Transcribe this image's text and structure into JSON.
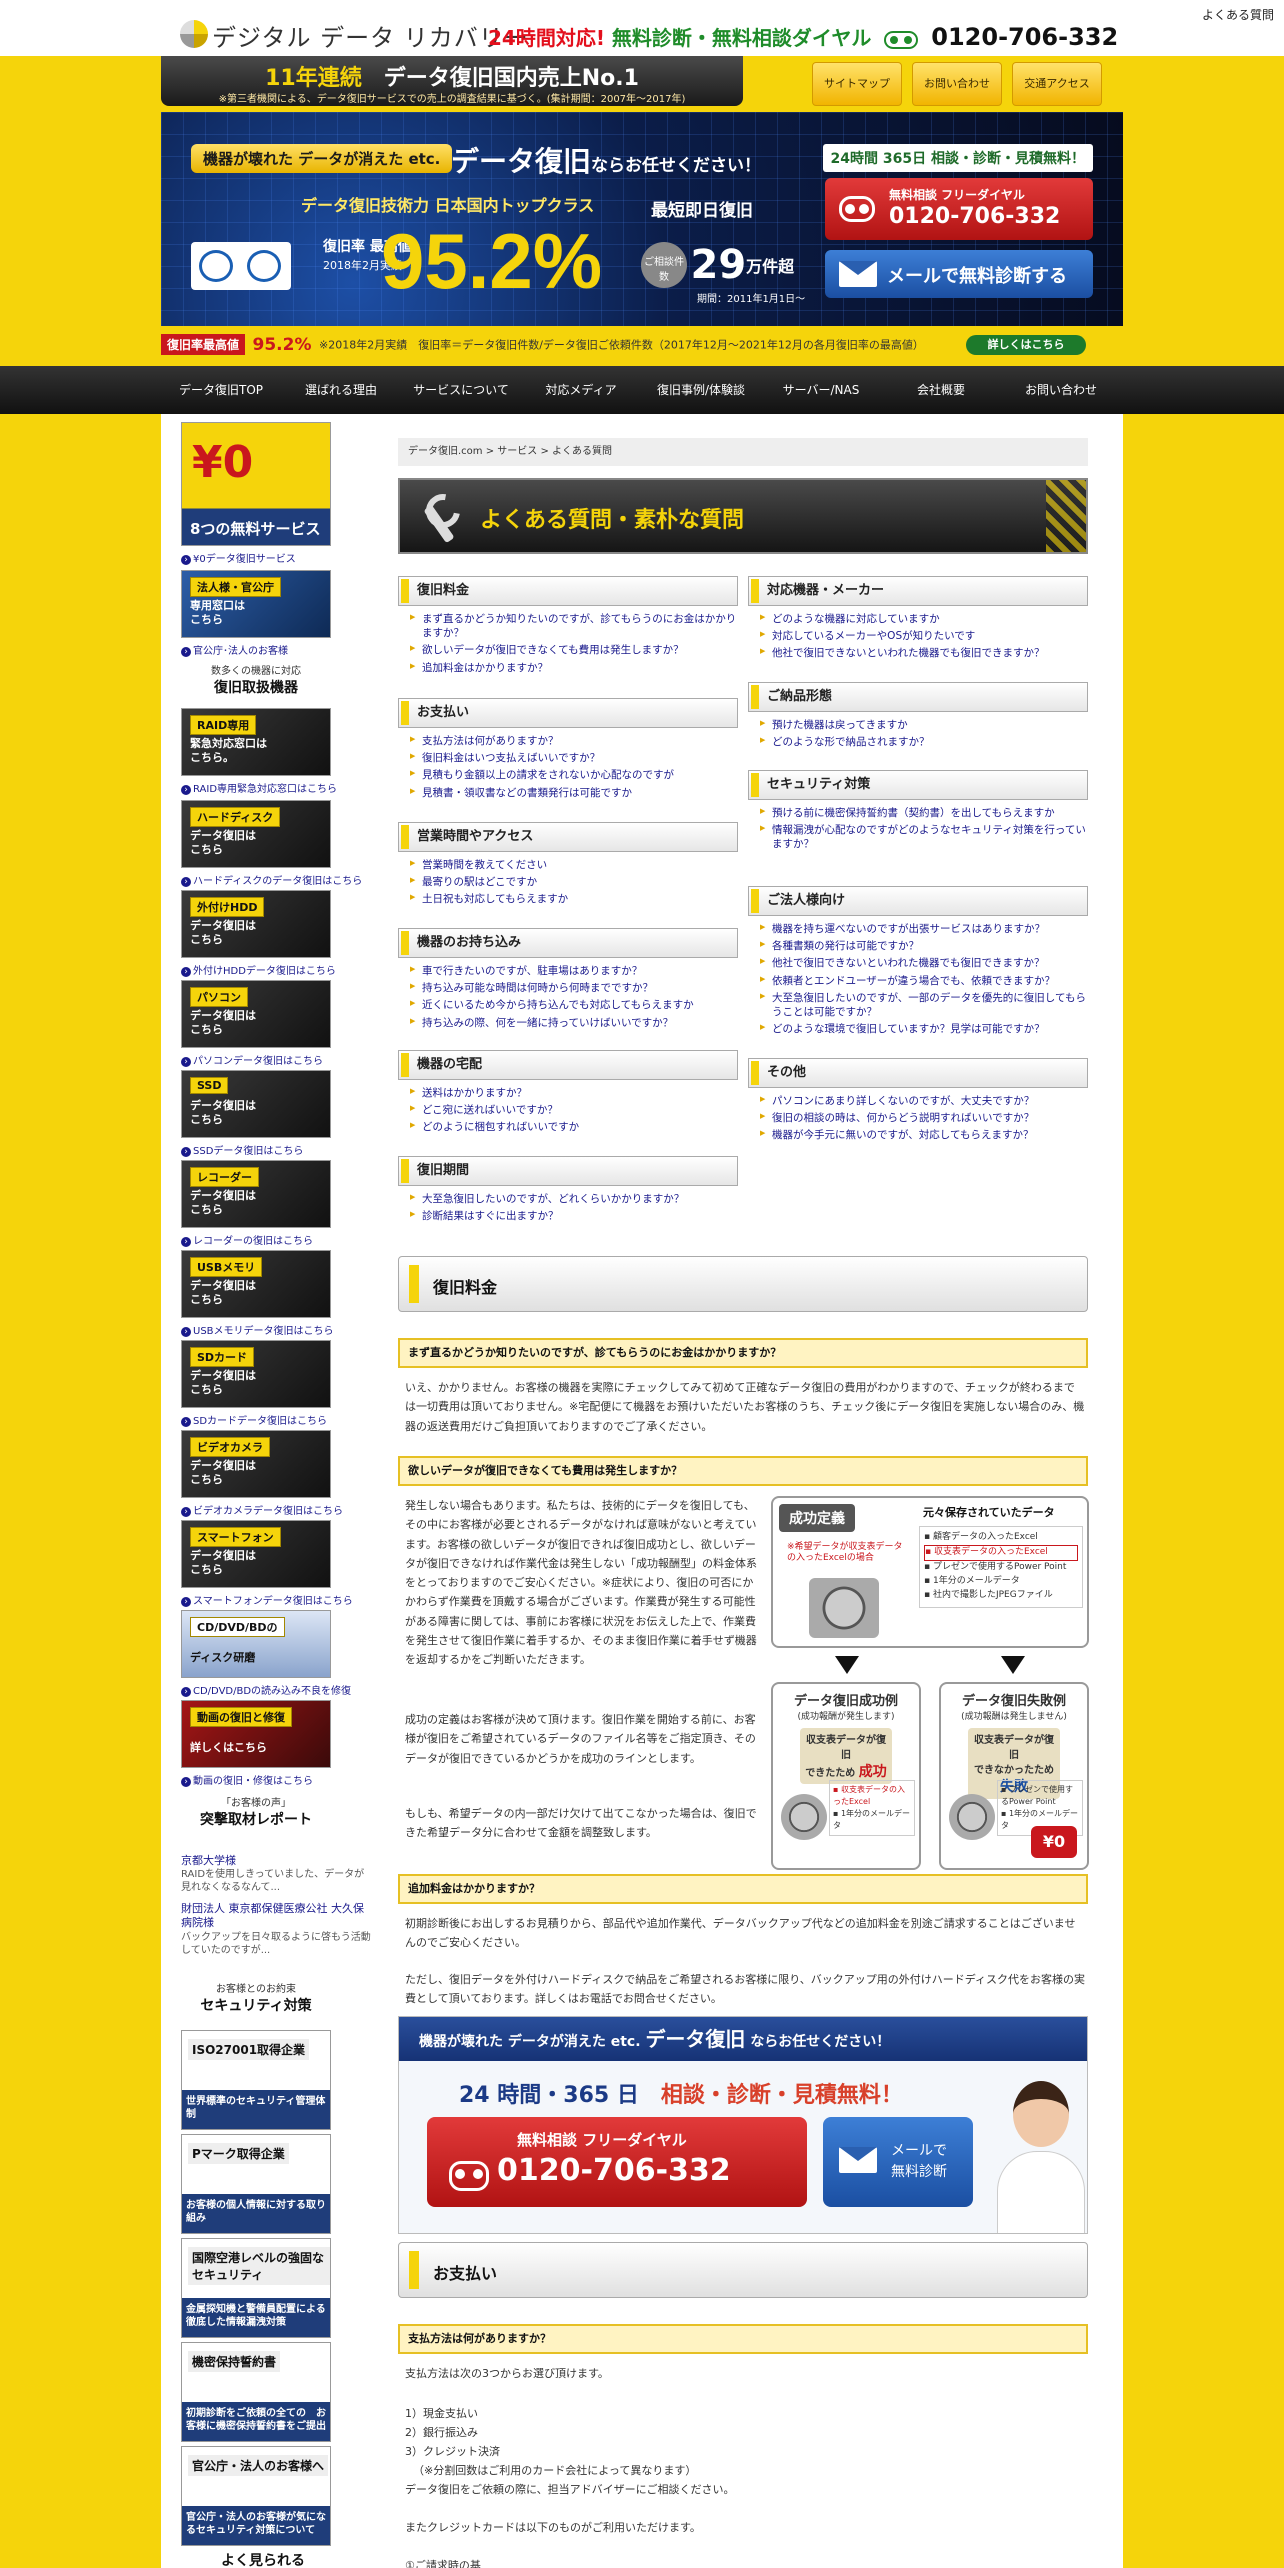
{
  "header": {
    "logo": "デジタル データ リカバリー",
    "faq_link": "よくある質問",
    "phone_prefix_red": "24時間対応!",
    "phone_prefix_green": "無料診断・無料相談ダイヤル",
    "phone_number": "0120-706-332"
  },
  "ribbon": {
    "title_prefix": "11年連続",
    "title_main": "データ復旧国内売上No.1",
    "note": "※第三者機関による、データ復旧サービスでの売上の調査結果に基づく。(集計期間：2007年～2017年)"
  },
  "top_links": [
    "サイトマップ",
    "お問い合わせ",
    "交通アクセス"
  ],
  "hero": {
    "pill": "機器が壊れた データが消えた etc.",
    "main_copy": "データ復旧",
    "main_copy_suffix": "ならお任せください！",
    "skill": "データ復旧技術力 日本国内トップクラス",
    "fast": "最短即日復旧",
    "rate_label": "復旧率 最高値",
    "rate_date": "2018年2月実績",
    "rate": "95.2%",
    "consult_label": "ご相談件数",
    "consult_count": "29",
    "consult_unit": "万件超",
    "period": "期間：2011年1月1日～",
    "r365": "24時間 365日 相談・診断・見積無料！",
    "dial_title": "無料相談 フリーダイヤル",
    "dial_number": "0120-706-332",
    "mail_label": "メールで無料診断する"
  },
  "rate_strip": {
    "label": "復旧率最高値",
    "pct": "95.2%",
    "note": "※2018年2月実績　復旧率＝データ復旧件数/データ復旧ご依頼件数（2017年12月～2021年12月の各月復旧率の最高値）",
    "detail": "詳しくはこちら"
  },
  "nav": [
    "データ復旧TOP",
    "選ばれる理由",
    "サービスについて",
    "対応メディア",
    "復旧事例/体験談",
    "サーバー/NAS",
    "会社概要",
    "お問い合わせ"
  ],
  "sidebar": {
    "cards": [
      {
        "tag": "¥0",
        "text": "8つの無料サービス",
        "link": "¥0データ復旧サービス"
      },
      {
        "tag": "法人様・官公庁",
        "text": "専用窓口は\nこちら",
        "link": "官公庁･法人のお客様"
      },
      {
        "tag": "RAID専用",
        "text": "緊急対応窓口は\nこちら。",
        "link": "RAID専用緊急対応窓口はこちら"
      },
      {
        "tag": "ハードディスク",
        "text": "データ復旧は\nこちら",
        "link": "ハードディスクのデータ復旧はこちら"
      },
      {
        "tag": "外付けHDD",
        "text": "データ復旧は\nこちら",
        "link": "外付けHDDデータ復旧はこちら"
      },
      {
        "tag": "パソコン",
        "text": "データ復旧は\nこちら",
        "link": "パソコンデータ復旧はこちら"
      },
      {
        "tag": "SSD",
        "text": "データ復旧は\nこちら",
        "link": "SSDデータ復旧はこちら"
      },
      {
        "tag": "レコーダー",
        "text": "データ復旧は\nこちら",
        "link": "レコーダーの復旧はこちら"
      },
      {
        "tag": "USBメモリ",
        "text": "データ復旧は\nこちら",
        "link": "USBメモリデータ復旧はこちら"
      },
      {
        "tag": "SDカード",
        "text": "データ復旧は\nこちら",
        "link": "SDカードデータ復旧はこちら"
      },
      {
        "tag": "ビデオカメラ",
        "text": "データ復旧は\nこちら",
        "link": "ビデオカメラデータ復旧はこちら"
      },
      {
        "tag": "スマートフォン",
        "text": "データ復旧は\nこちら",
        "link": "スマートフォンデータ復旧はこちら"
      },
      {
        "tag": "CD/DVD/BDの",
        "text": "ディスク研磨",
        "link": "CD/DVD/BDの読み込み不良を修復"
      },
      {
        "tag": "動画の復旧と修復",
        "text": "詳しくはこちら",
        "link": "動画の復旧・修復はこちら"
      }
    ],
    "devices_title": "復旧取扱機器",
    "devices_sub": "数多くの機器に対応",
    "report_sub": "「お客様の声」",
    "report_title": "突撃取材レポート",
    "news": [
      {
        "title": "京都大学様",
        "desc": "RAIDを使用しきっていました、データが見れなくなるなんて..."
      },
      {
        "title": "財団法人 東京都保健医療公社 大久保病院様",
        "desc": "バックアップを日々取るように啓もう活動していたのですが..."
      }
    ],
    "security_sub": "お客様とのお約束",
    "security_title": "セキュリティ対策",
    "security": [
      {
        "head": "ISO27001取得企業",
        "foot": "世界標準のセキュリティ管理体制"
      },
      {
        "head": "Pマーク取得企業",
        "foot": "お客様の個人情報に対する取り組み"
      },
      {
        "head": "国際空港レベルの強固なセキュリティ",
        "foot": "金属探知機と警備員配置による徹底した情報漏洩対策"
      },
      {
        "head": "機密保持誓約書",
        "foot": "初期診断をご依頼の全ての　お客様に機密保持誓約書をご提出"
      },
      {
        "head": "官公庁・法人のお客様へ",
        "foot": "官公庁・法人のお客様が気になるセキュリティ対策について"
      }
    ],
    "bottom_title": "よく見られる"
  },
  "breadcrumb": "データ復旧.com > サービス > よくある質問",
  "page_title": "よくある質問・素朴な質問",
  "faq_left": [
    {
      "title": "復旧料金",
      "items": [
        "まず直るかどうか知りたいのですが、診てもらうのにお金はかかりますか？",
        "欲しいデータが復旧できなくても費用は発生しますか？",
        "追加料金はかかりますか？"
      ]
    },
    {
      "title": "お支払い",
      "items": [
        "支払方法は何がありますか？",
        "復旧料金はいつ支払えばいいですか？",
        "見積もり金額以上の請求をされないか心配なのですが",
        "見積書・領収書などの書類発行は可能ですか"
      ]
    },
    {
      "title": "営業時間やアクセス",
      "items": [
        "営業時間を教えてください",
        "最寄りの駅はどこですか",
        "土日祝も対応してもらえますか"
      ]
    },
    {
      "title": "機器のお持ち込み",
      "items": [
        "車で行きたいのですが、駐車場はありますか？",
        "持ち込み可能な時間は何時から何時までですか？",
        "近くにいるため今から持ち込んでも対応してもらえますか",
        "持ち込みの際、何を一緒に持っていけばいいですか？"
      ]
    },
    {
      "title": "機器の宅配",
      "items": [
        "送料はかかりますか？",
        "どこ宛に送ればいいですか？",
        "どのように梱包すればいいですか"
      ]
    },
    {
      "title": "復旧期間",
      "items": [
        "大至急復旧したいのですが、どれくらいかかりますか？",
        "診断結果はすぐに出ますか？"
      ]
    }
  ],
  "faq_right": [
    {
      "title": "対応機器・メーカー",
      "items": [
        "どのような機器に対応していますか",
        "対応しているメーカーやOSが知りたいです",
        "他社で復旧できないといわれた機器でも復旧できますか？"
      ]
    },
    {
      "title": "ご納品形態",
      "items": [
        "預けた機器は戻ってきますか",
        "どのような形で納品されますか？"
      ]
    },
    {
      "title": "セキュリティ対策",
      "items": [
        "預ける前に機密保持誓約書（契約書）を出してもらえますか",
        "情報漏洩が心配なのですがどのようなセキュリティ対策を行っていますか？"
      ]
    },
    {
      "title": "ご法人様向け",
      "items": [
        "機器を持ち運べないのですが出張サービスはありますか？",
        "各種書類の発行は可能ですか？",
        "他社で復旧できないといわれた機器でも復旧できますか？",
        "依頼者とエンドユーザーが違う場合でも、依頼できますか？",
        "大至急復旧したいのですが、一部のデータを優先的に復旧してもらうことは可能ですか？",
        "どのような環境で復旧していますか？見学は可能ですか？"
      ]
    },
    {
      "title": "その他",
      "items": [
        "パソコンにあまり詳しくないのですが、大丈夫ですか？",
        "復旧の相談の時は、何からどう説明すればいいですか？",
        "機器が今手元に無いのですが、対応してもらえますか？"
      ]
    }
  ],
  "section_fee": {
    "title": "復旧料金",
    "q1": "まず直るかどうか知りたいのですが、診てもらうのにお金はかかりますか？",
    "a1": "いえ、かかりません。お客様の機器を実際にチェックしてみて初めて正確なデータ復旧の費用がわかりますので、チェックが終わるまでは一切費用は頂いておりません。※宅配便にて機器をお預けいただいたお客様のうち、チェック後にデータ復旧を実施しない場合のみ、機器の返送費用だけご負担頂いておりますのでご了承ください。",
    "q2": "欲しいデータが復旧できなくても費用は発生しますか？",
    "a2_1": "発生しない場合もあります。私たちは、技術的にデータを復旧しても、その中にお客様が必要とされるデータがなければ意味がないと考えています。お客様の欲しいデータが復旧できれば復旧成功とし、欲しいデータが復旧できなければ作業代金は発生しない「成功報酬型」の料金体系をとっておりますのでご安心ください。※症状により、復旧の可否にかかわらず作業費を頂戴する場合がございます。作業費が発生する可能性がある障害に関しては、事前にお客様に状況をお伝えした上で、作業費を発生させて復旧作業に着手するか、そのまま復旧作業に着手せず機器を返却するかをご判断いただきます。",
    "a2_2": "成功の定義はお客様が決めて頂けます。復旧作業を開始する前に、お客様が復旧をご希望されているデータのファイル名等をご指定頂き、そのデータが復旧できているかどうかを成功のラインとします。",
    "a2_3": "もしも、希望データの内一部だけ欠けて出てこなかった場合は、復旧できた希望データ分に合わせて金額を調整致します。",
    "q3": "追加料金はかかりますか？",
    "a3_1": "初期診断後にお出しするお見積りから、部品代や追加作業代、データバックアップ代などの追加料金を別途ご請求することはございませんのでご安心ください。",
    "a3_2": "ただし、復旧データを外付けハードディスクで納品をご希望されるお客様に限り、バックアップ用の外付けハードディスク代をお客様の実費として頂いております。詳しくはお電話でお問合せください。"
  },
  "diagram": {
    "def": "成功定義",
    "note": "※希望データが収支表データの入ったExcelの場合",
    "caption": "元々保存されていたデータ",
    "list": [
      "顧客データの入ったExcel",
      "収支表データの入ったExcel",
      "プレゼンで使用するPower Point",
      "1年分のメールデータ",
      "社内で撮影したJPEGファイル"
    ],
    "ok_title": "データ復旧成功例",
    "ok_sub": "(成功報酬が発生します)",
    "ok_res1": "収支表データが復旧",
    "ok_res2": "できたため",
    "ok_res3": "成功",
    "ok_list": [
      "収支表データの入ったExcel",
      "1年分のメールデータ"
    ],
    "ng_title": "データ復旧失敗例",
    "ng_sub": "(成功報酬は発生しません)",
    "ng_res1": "収支表データが復旧",
    "ng_res2": "できなかったため",
    "ng_res3": "失敗",
    "ng_list": [
      "プレゼンで使用するPower Point",
      "1年分のメールデータ"
    ],
    "zero": "¥0"
  },
  "cta": {
    "bar_prefix": "機器が壊れた データが消えた etc.",
    "bar_main": "データ復旧",
    "bar_suffix": "ならお任せください！",
    "h2a": "24 時間・365 日",
    "h2b": "相談・診断・見積無料！",
    "dial_title": "無料相談 フリーダイヤル",
    "dial_number": "0120-706-332",
    "mail": "メールで\n無料診断"
  },
  "section_pay": {
    "title": "お支払い",
    "q1": "支払方法は何がありますか？",
    "intro": "支払方法は次の3つからお選び頂けます。",
    "options": [
      "1）現金支払い",
      "2）銀行振込み",
      "3）クレジット決済",
      "（※分割回数はご利用のカード会社によって異なります）"
    ],
    "after": "データ復旧をご依頼の際に、担当アドバイザーにご相談ください。",
    "cards": "またクレジットカードは以下のものがご利用いただけます。",
    "last": "①ご請求時の基"
  }
}
